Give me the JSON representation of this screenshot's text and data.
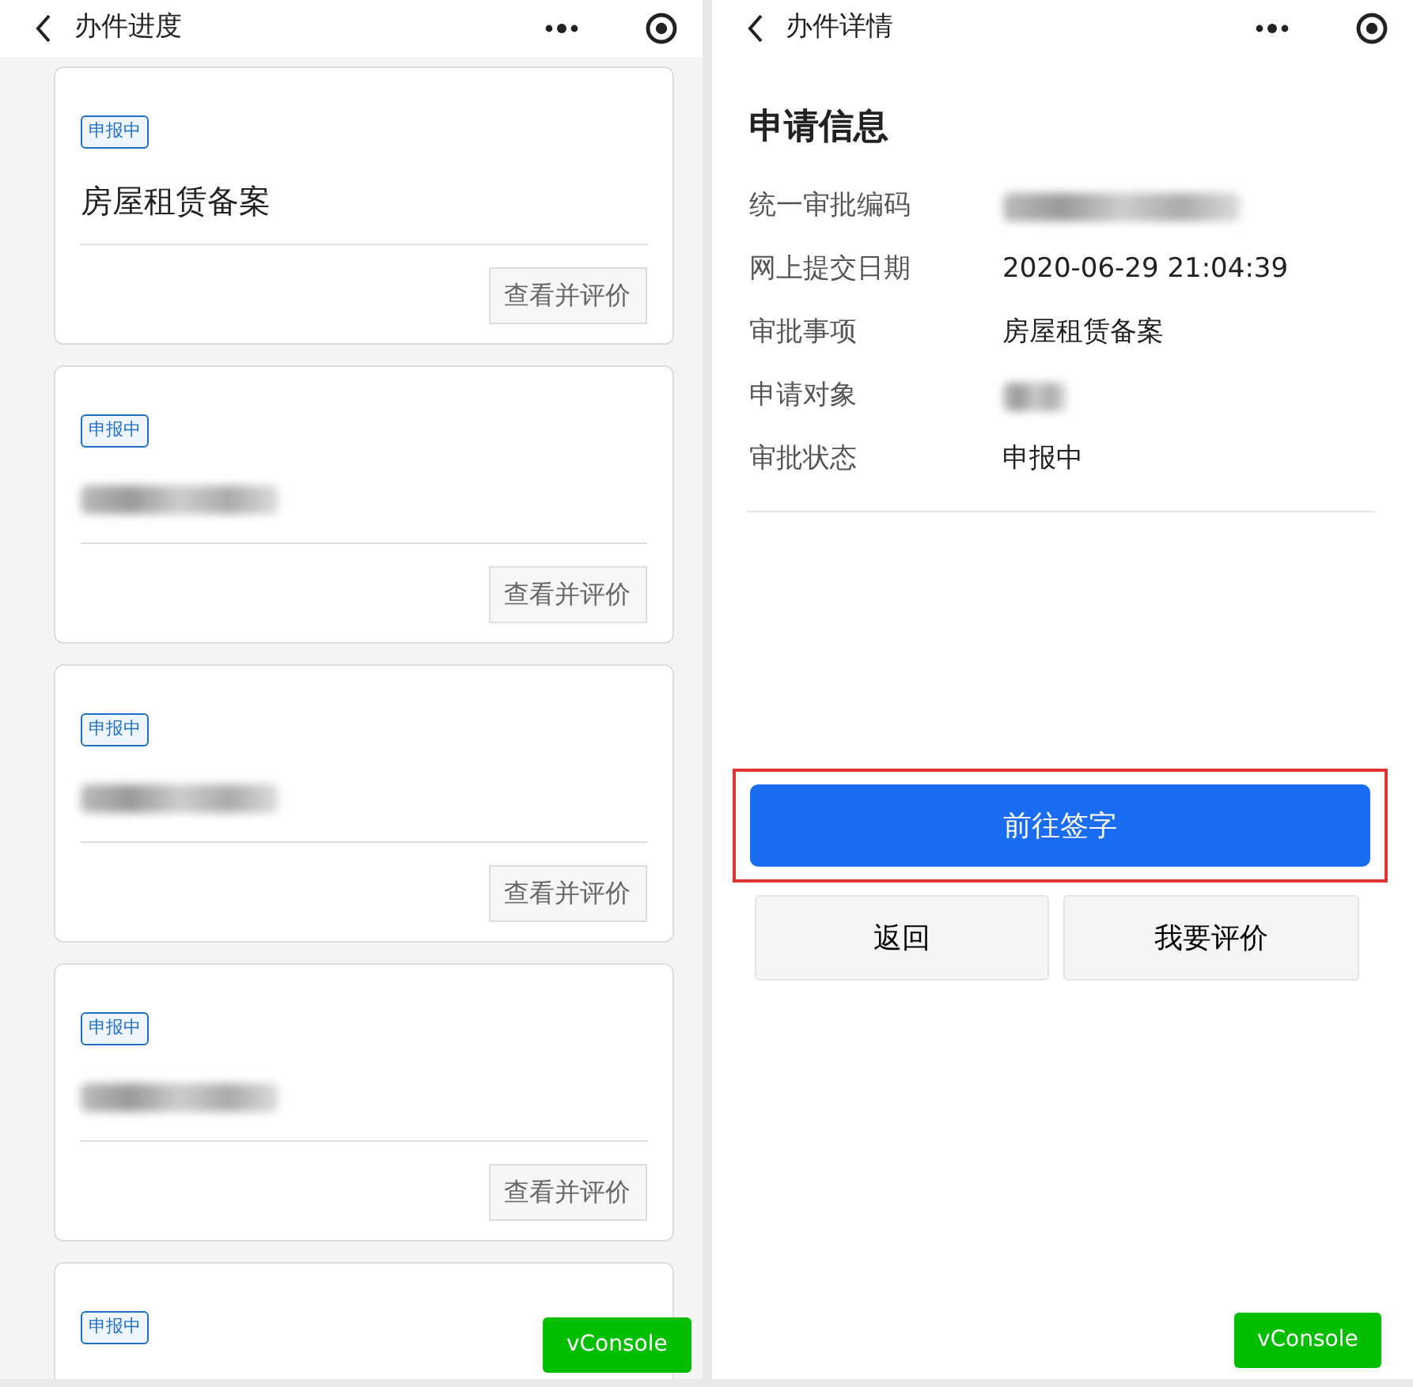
{
  "left_screen": {
    "title": "办件进度",
    "cards": [
      {
        "status": "申报中",
        "title": "房屋租赁备案",
        "blurred": false,
        "action": "查看并评价"
      },
      {
        "status": "申报中",
        "blurred": true,
        "action": "查看并评价"
      },
      {
        "status": "申报中",
        "blurred": true,
        "action": "查看并评价"
      },
      {
        "status": "申报中",
        "blurred": true,
        "action": "查看并评价"
      },
      {
        "status": "申报中"
      }
    ],
    "vconsole": "vConsole"
  },
  "right_screen": {
    "title": "办件详情",
    "section_title": "申请信息",
    "fields": [
      {
        "label": "统一审批编码",
        "blurred": true
      },
      {
        "label": "网上提交日期",
        "value": "2020-06-29 21:04:39"
      },
      {
        "label": "审批事项",
        "value": "房屋租赁备案"
      },
      {
        "label": "申请对象",
        "blurred": true
      },
      {
        "label": "审批状态",
        "value": "申报中"
      }
    ],
    "primary_button": {
      "label": "前往签字",
      "highlighted": true
    },
    "buttons": [
      "返回",
      "我要评价"
    ],
    "vconsole": "vConsole"
  }
}
